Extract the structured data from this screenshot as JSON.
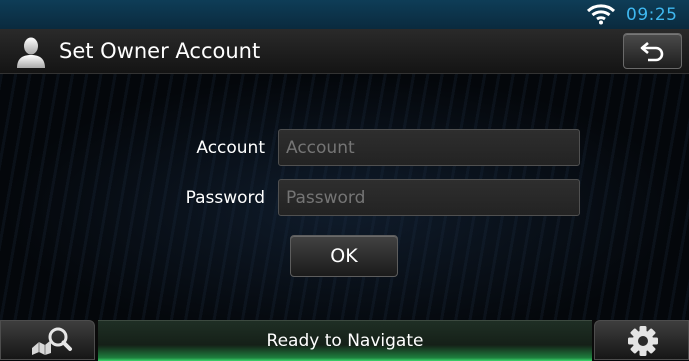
{
  "status_bar": {
    "time": "09:25",
    "wifi_icon": "wifi-icon",
    "accent_color": "#3fb8f0"
  },
  "header": {
    "title": "Set Owner Account",
    "user_icon": "user-icon",
    "back_icon": "back-arrow-icon"
  },
  "form": {
    "account": {
      "label": "Account",
      "placeholder": "Account",
      "value": ""
    },
    "password": {
      "label": "Password",
      "placeholder": "Password",
      "value": ""
    },
    "ok_label": "OK"
  },
  "footer": {
    "search_icon": "map-search-icon",
    "status_text": "Ready to Navigate",
    "status_color": "#3bd86c",
    "settings_icon": "gear-icon"
  }
}
